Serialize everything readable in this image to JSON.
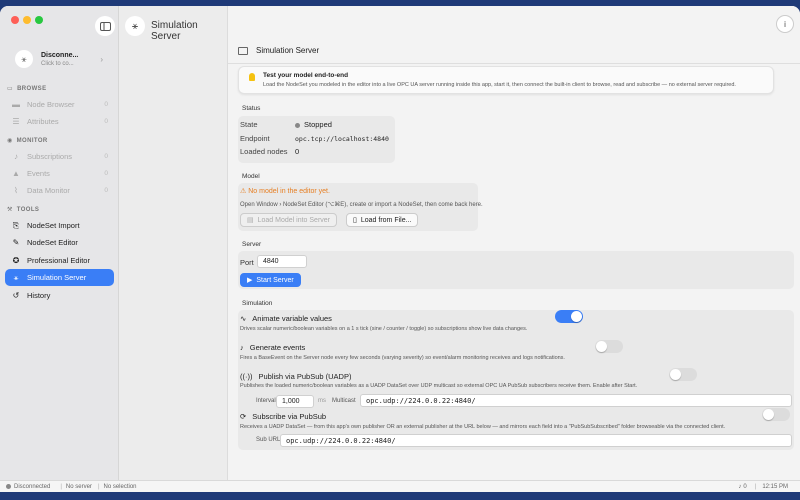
{
  "sidebar": {
    "connection": {
      "title": "Disconne...",
      "subtitle": "Click to co..."
    },
    "sections": {
      "browse": "BROWSE",
      "monitor": "MONITOR",
      "tools": "TOOLS"
    },
    "browse_items": [
      {
        "label": "Node Browser",
        "count": "0"
      },
      {
        "label": "Attributes",
        "count": "0"
      }
    ],
    "monitor_items": [
      {
        "label": "Subscriptions",
        "count": "0"
      },
      {
        "label": "Events",
        "count": "0"
      },
      {
        "label": "Data Monitor",
        "count": "0"
      }
    ],
    "tools_items": [
      {
        "label": "NodeSet Import"
      },
      {
        "label": "NodeSet Editor"
      },
      {
        "label": "Professional Editor"
      },
      {
        "label": "Simulation Server"
      },
      {
        "label": "History"
      }
    ]
  },
  "middle": {
    "title": "Simulation Server"
  },
  "detail": {
    "header": "Simulation Server",
    "tip": {
      "title": "Test your model end-to-end",
      "body": "Load the NodeSet you modeled in the editor into a live OPC UA server running inside this app, start it, then connect the built-in client to browse, read and subscribe — no external server required."
    },
    "status": {
      "heading": "Status",
      "state_label": "State",
      "state_value": "Stopped",
      "endpoint_label": "Endpoint",
      "endpoint_value": "opc.tcp://localhost:4840",
      "nodes_label": "Loaded nodes",
      "nodes_value": "0"
    },
    "model": {
      "heading": "Model",
      "warning": "No model in the editor yet.",
      "hint": "Open Window › NodeSet Editor (⌥⌘E), create or import a NodeSet, then come back here.",
      "load_editor": "Load Model into Server",
      "load_file": "Load from File..."
    },
    "server": {
      "heading": "Server",
      "port_label": "Port",
      "port_value": "4840",
      "start": "Start Server"
    },
    "simulation": {
      "heading": "Simulation",
      "animate_title": "Animate variable values",
      "animate_desc": "Drives scalar numeric/boolean variables on a 1 s tick (sine / counter / toggle) so subscriptions show live data changes.",
      "animate_on": true,
      "events_title": "Generate events",
      "events_desc": "Fires a BaseEvent on the Server node every few seconds (varying severity) so event/alarm monitoring receives and logs notifications.",
      "events_on": false,
      "pub_title": "Publish via PubSub (UADP)",
      "pub_desc": "Publishes the loaded numeric/boolean variables as a UADP DataSet over UDP multicast so external OPC UA PubSub subscribers receive them. Enable after Start.",
      "pub_on": false,
      "interval_label": "Interval",
      "interval_value": "1,000",
      "interval_unit": "ms",
      "multicast_label": "Multicast",
      "multicast_value": "opc.udp://224.0.0.22:4840/",
      "sub_title": "Subscribe via PubSub",
      "sub_desc": "Receives a UADP DataSet — from this app's own publisher OR an external publisher at the URL below — and mirrors each field into a \"PubSubSubscribed\" folder browseable via the connected client.",
      "sub_on": false,
      "suburl_label": "Sub URL",
      "suburl_value": "opc.udp://224.0.0.22:4840/"
    }
  },
  "statusbar": {
    "connection": "Disconnected",
    "server": "No server",
    "selection": "No selection",
    "alerts": "0",
    "time": "12:15 PM"
  },
  "colors": {
    "accent": "#3a7ef6",
    "warning": "#e67e22"
  }
}
